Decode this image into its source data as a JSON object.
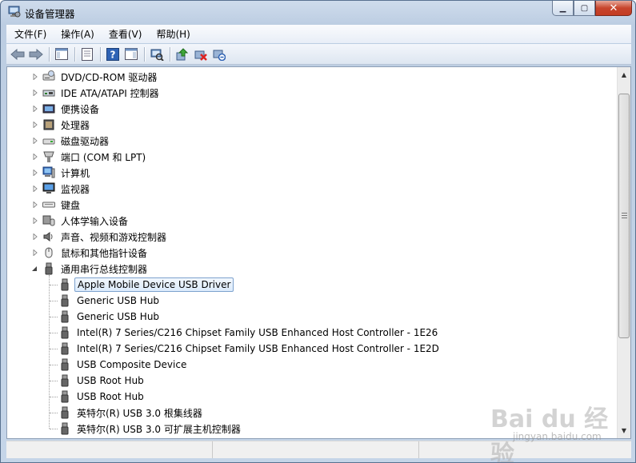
{
  "window": {
    "title": "设备管理器",
    "buttons": {
      "minimize": "▁",
      "maximize": "▢",
      "close": "✕"
    }
  },
  "menu": [
    {
      "label": "文件(F)"
    },
    {
      "label": "操作(A)"
    },
    {
      "label": "查看(V)"
    },
    {
      "label": "帮助(H)"
    }
  ],
  "toolbar": [
    {
      "icon": "back-arrow-icon"
    },
    {
      "icon": "forward-arrow-icon"
    },
    {
      "sep": true
    },
    {
      "icon": "show-hide-console-tree-icon"
    },
    {
      "sep": true
    },
    {
      "icon": "properties-icon"
    },
    {
      "sep": true
    },
    {
      "icon": "help-icon"
    },
    {
      "icon": "show-action-pane-icon"
    },
    {
      "sep": true
    },
    {
      "icon": "scan-hardware-icon"
    },
    {
      "sep": true
    },
    {
      "icon": "update-driver-icon"
    },
    {
      "icon": "disable-device-icon"
    },
    {
      "icon": "uninstall-device-icon"
    }
  ],
  "tree": {
    "categories": [
      {
        "label": "DVD/CD-ROM 驱动器",
        "icon": "dvd-drive-icon",
        "expanded": false
      },
      {
        "label": "IDE ATA/ATAPI 控制器",
        "icon": "ide-controller-icon",
        "expanded": false
      },
      {
        "label": "便携设备",
        "icon": "portable-device-icon",
        "expanded": false
      },
      {
        "label": "处理器",
        "icon": "processor-icon",
        "expanded": false
      },
      {
        "label": "磁盘驱动器",
        "icon": "disk-drive-icon",
        "expanded": false
      },
      {
        "label": "端口 (COM 和 LPT)",
        "icon": "port-icon",
        "expanded": false
      },
      {
        "label": "计算机",
        "icon": "computer-icon",
        "expanded": false
      },
      {
        "label": "监视器",
        "icon": "monitor-icon",
        "expanded": false
      },
      {
        "label": "键盘",
        "icon": "keyboard-icon",
        "expanded": false
      },
      {
        "label": "人体学输入设备",
        "icon": "hid-icon",
        "expanded": false
      },
      {
        "label": "声音、视频和游戏控制器",
        "icon": "sound-icon",
        "expanded": false
      },
      {
        "label": "鼠标和其他指针设备",
        "icon": "mouse-icon",
        "expanded": false
      },
      {
        "label": "通用串行总线控制器",
        "icon": "usb-icon",
        "expanded": true
      }
    ],
    "usb_children": [
      {
        "label": "Apple Mobile Device USB Driver",
        "selected": true
      },
      {
        "label": "Generic USB Hub"
      },
      {
        "label": "Generic USB Hub"
      },
      {
        "label": "Intel(R) 7 Series/C216 Chipset Family USB Enhanced Host Controller - 1E26"
      },
      {
        "label": "Intel(R) 7 Series/C216 Chipset Family USB Enhanced Host Controller - 1E2D"
      },
      {
        "label": "USB Composite Device"
      },
      {
        "label": "USB Root Hub"
      },
      {
        "label": "USB Root Hub"
      },
      {
        "label": "英特尔(R) USB 3.0 根集线器"
      },
      {
        "label": "英特尔(R) USB 3.0 可扩展主机控制器"
      }
    ]
  },
  "watermark": {
    "logo": "Bai du 经验",
    "url": "jingyan.baidu.com"
  },
  "colors": {
    "selection_border": "#7da2ce",
    "selection_fill": "#dcebfc",
    "title_bar": "#c5d5e8",
    "close_button": "#c7452d"
  }
}
